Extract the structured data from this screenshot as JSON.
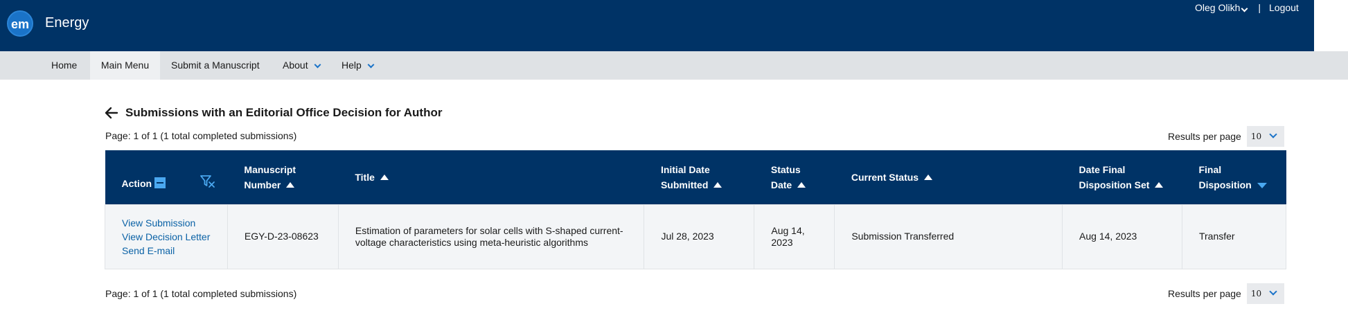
{
  "header": {
    "logo_text": "em",
    "app_title": "Energy",
    "user_name": "Oleg Olikh",
    "separator": "|",
    "logout_label": "Logout"
  },
  "nav": {
    "items": [
      {
        "label": "Home"
      },
      {
        "label": "Main Menu"
      },
      {
        "label": "Submit a Manuscript"
      },
      {
        "label": "About"
      },
      {
        "label": "Help"
      }
    ]
  },
  "page": {
    "title": "Submissions with an Editorial Office Decision for Author",
    "page_info_top": "Page: 1 of 1 (1 total completed submissions)",
    "page_info_bottom": "Page: 1 of 1 (1 total completed submissions)",
    "results_per_page_label": "Results per page",
    "results_per_page_value": "10"
  },
  "table": {
    "headers": {
      "action": "Action",
      "manuscript_number_1": "Manuscript",
      "manuscript_number_2": "Number",
      "title": "Title",
      "initial_date_1": "Initial Date",
      "initial_date_2": "Submitted",
      "status_date_1": "Status",
      "status_date_2": "Date",
      "current_status": "Current Status",
      "date_final_1": "Date Final",
      "date_final_2": "Disposition Set",
      "final_disposition_1": "Final",
      "final_disposition_2": "Disposition"
    },
    "rows": [
      {
        "actions": [
          "View Submission",
          "View Decision Letter",
          "Send E-mail"
        ],
        "manuscript_number": "EGY-D-23-08623",
        "title": "Estimation of parameters for solar cells with S-shaped current-voltage characteristics using meta-heuristic algorithms",
        "initial_date": "Jul 28, 2023",
        "status_date": "Aug 14, 2023",
        "current_status": "Submission Transferred",
        "date_final": "Aug 14, 2023",
        "final_disposition": "Transfer"
      }
    ]
  },
  "colors": {
    "header_bg": "#003366",
    "nav_bg": "#dfe2e5",
    "link": "#0b62a6",
    "accent": "#4aa8f0"
  }
}
